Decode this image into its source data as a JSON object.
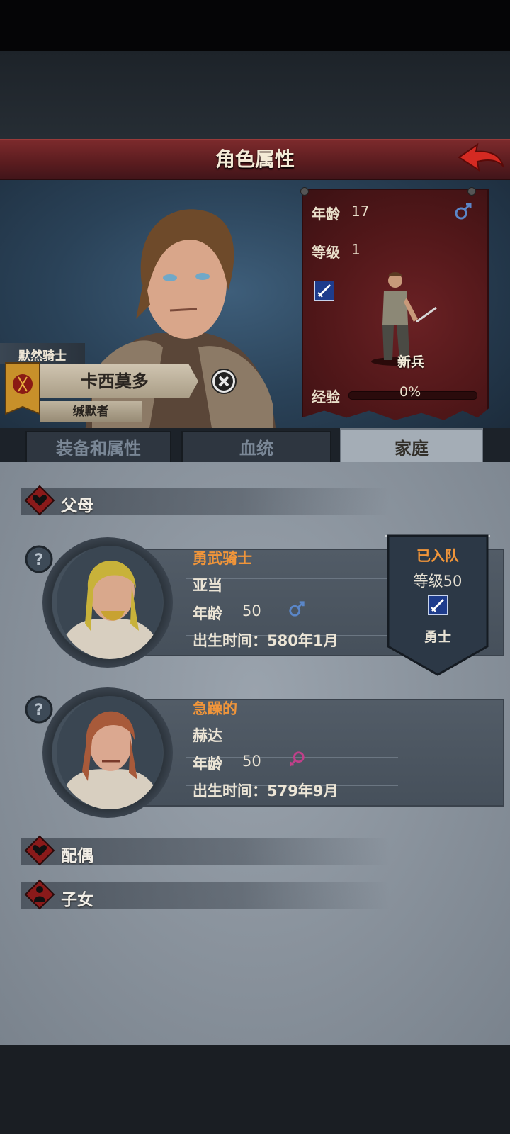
{
  "header": {
    "title": "角色属性",
    "back_icon": "back-arrow-icon"
  },
  "character": {
    "faction": "默然骑士",
    "name": "卡西莫多",
    "title": "缄默者",
    "stats": {
      "age_label": "年龄",
      "age": "17",
      "level_label": "等级",
      "level": "1",
      "class": "新兵",
      "exp_label": "经验",
      "exp": "0%",
      "exp_fraction": 0
    }
  },
  "tabs": [
    {
      "label": "装备和属性",
      "active": false
    },
    {
      "label": "血统",
      "active": false
    },
    {
      "label": "家庭",
      "active": true
    }
  ],
  "family": {
    "parents_label": "父母",
    "spouse_label": "配偶",
    "children_label": "子女",
    "parents": [
      {
        "trait": "勇武骑士",
        "name": "亚当",
        "age_label": "年龄",
        "age": "50",
        "gender": "male",
        "birth": "出生时间：580年1月",
        "status": {
          "joined": "已入队",
          "level": "等级50",
          "class": "勇士"
        }
      },
      {
        "trait": "急躁的",
        "name": "赫达",
        "age_label": "年龄",
        "age": "50",
        "gender": "female",
        "birth": "出生时间：579年9月"
      }
    ]
  },
  "colors": {
    "trait": "#f0953a",
    "male": "#5a86c8",
    "female": "#c0408a",
    "title_bar": "#6a2326"
  }
}
